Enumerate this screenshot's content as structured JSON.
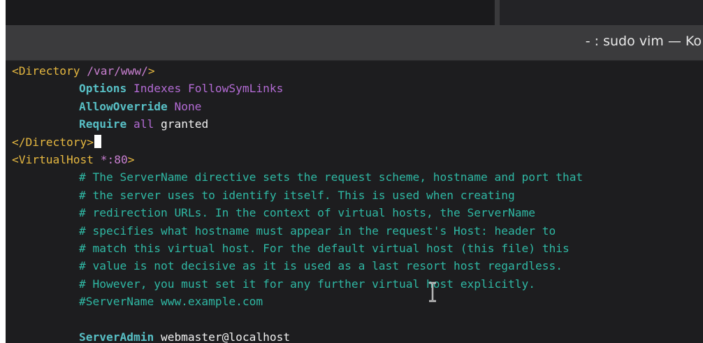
{
  "window": {
    "title": "- : sudo vim — Ko"
  },
  "editor": {
    "lines": [
      {
        "indent": false,
        "parts": [
          {
            "cls": "tag",
            "text": "<Directory "
          },
          {
            "cls": "path",
            "text": "/var/www/"
          },
          {
            "cls": "tag",
            "text": ">"
          }
        ]
      },
      {
        "indent": true,
        "parts": [
          {
            "cls": "dir",
            "text": "Options"
          },
          {
            "cls": "val",
            "text": " Indexes FollowSymLinks"
          }
        ]
      },
      {
        "indent": true,
        "parts": [
          {
            "cls": "dir",
            "text": "AllowOverride"
          },
          {
            "cls": "val",
            "text": " None"
          }
        ]
      },
      {
        "indent": true,
        "parts": [
          {
            "cls": "dir",
            "text": "Require"
          },
          {
            "cls": "val",
            "text": " all"
          },
          {
            "cls": "plain",
            "text": " granted"
          }
        ]
      },
      {
        "indent": false,
        "cursor": true,
        "parts": [
          {
            "cls": "tag",
            "text": "</Directory>"
          }
        ]
      },
      {
        "indent": false,
        "parts": [
          {
            "cls": "tag",
            "text": "<VirtualHost "
          },
          {
            "cls": "path",
            "text": "*:80"
          },
          {
            "cls": "tag",
            "text": ">"
          }
        ]
      },
      {
        "indent": true,
        "parts": [
          {
            "cls": "comment",
            "text": "# The ServerName directive sets the request scheme, hostname and port that"
          }
        ]
      },
      {
        "indent": true,
        "parts": [
          {
            "cls": "comment",
            "text": "# the server uses to identify itself. This is used when creating"
          }
        ]
      },
      {
        "indent": true,
        "parts": [
          {
            "cls": "comment",
            "text": "# redirection URLs. In the context of virtual hosts, the ServerName"
          }
        ]
      },
      {
        "indent": true,
        "parts": [
          {
            "cls": "comment",
            "text": "# specifies what hostname must appear in the request's Host: header to"
          }
        ]
      },
      {
        "indent": true,
        "parts": [
          {
            "cls": "comment",
            "text": "# match this virtual host. For the default virtual host (this file) this"
          }
        ]
      },
      {
        "indent": true,
        "parts": [
          {
            "cls": "comment",
            "text": "# value is not decisive as it is used as a last resort host regardless."
          }
        ]
      },
      {
        "indent": true,
        "parts": [
          {
            "cls": "comment",
            "text": "# However, you must set it for any further virtual host explicitly."
          }
        ]
      },
      {
        "indent": true,
        "parts": [
          {
            "cls": "comment",
            "text": "#ServerName www.example.com"
          }
        ]
      },
      {
        "indent": false,
        "parts": []
      },
      {
        "indent": true,
        "parts": [
          {
            "cls": "dir",
            "text": "ServerAdmin"
          },
          {
            "cls": "plain",
            "text": " webmaster@localhost"
          }
        ]
      }
    ]
  },
  "colors": {
    "tag": "#e6b840",
    "path": "#c87fd0",
    "directive": "#58c0c6",
    "value": "#b36bd4",
    "comment": "#2fb8a4",
    "background": "#1d1d1f",
    "titlebar": "#3b3b3d"
  },
  "mouse_pointer": "i-beam-cursor-icon"
}
